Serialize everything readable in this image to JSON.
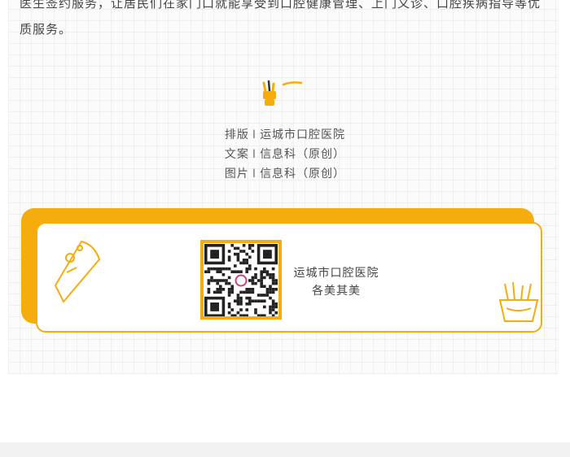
{
  "article": {
    "intro_line1": "医生签约服务，让居民们在家门口就能享受到口腔健康管理、上门义诊、口腔疾病指导等优",
    "intro_line2": "质服务。"
  },
  "credits": [
    {
      "role": "排版",
      "separator": "I",
      "value": "运城市口腔医院"
    },
    {
      "role": "文案",
      "separator": "I",
      "value": "信息科（原创）"
    },
    {
      "role": "图片",
      "separator": "I",
      "value": "信息科（原创）"
    }
  ],
  "card": {
    "hospital_name": "运城市口腔医院",
    "slogan": "各美其美"
  },
  "colors": {
    "accent": "#f5ad0d",
    "text": "#555555"
  },
  "icons": [
    "hand-sign-icon",
    "qr-code",
    "ice-cream-icon",
    "fries-icon"
  ]
}
